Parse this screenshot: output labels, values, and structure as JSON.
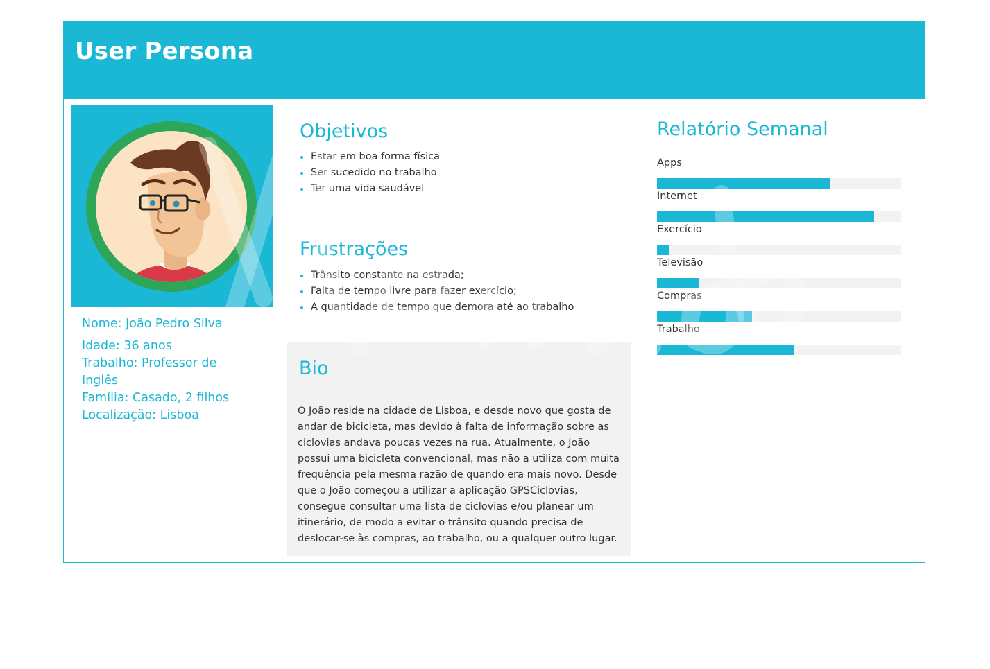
{
  "header": {
    "title": "User Persona"
  },
  "profile": {
    "name": "Nome: João Pedro Silva",
    "age": "Idade: 36 anos",
    "job": "Trabalho: Professor de Inglês",
    "family": "Família: Casado, 2 filhos",
    "location": "Localização: Lisboa"
  },
  "objectives": {
    "title": "Objetivos",
    "items": [
      "Estar em boa forma física",
      "Ser sucedido no trabalho",
      "Ter uma vida saudável"
    ]
  },
  "frustrations": {
    "title": "Frustrações",
    "items": [
      "Trânsito constante na estrada;",
      "Falta de tempo livre para fazer exercício;",
      "A quantidade de tempo que demora até ao trabalho"
    ]
  },
  "bio": {
    "title": "Bio",
    "text": "O João reside na cidade de Lisboa, e desde novo que gosta de andar de bicicleta, mas devido à falta de informação sobre as ciclovias andava poucas vezes na rua. Atualmente, o João possui uma bicicleta convencional, mas não a utiliza com muita frequência pela mesma razão de quando era mais novo. Desde que o João começou a utilizar a aplicação GPSCiclovias, consegue consultar uma lista de ciclovias e/ou planear um itinerário, de modo a evitar o trânsito quando precisa de deslocar-se às compras, ao trabalho, ou a qualquer outro lugar."
  },
  "weekly_report": {
    "title": "Relatório Semanal",
    "items": [
      {
        "label": "Apps",
        "value": 71
      },
      {
        "label": "Internet",
        "value": 89
      },
      {
        "label": "Exercício",
        "value": 5
      },
      {
        "label": "Televisão",
        "value": 17
      },
      {
        "label": "Compras",
        "value": 39
      },
      {
        "label": "Trabalho",
        "value": 56
      }
    ]
  },
  "colors": {
    "accent": "#1bb8d6",
    "track": "#f2f2f2",
    "avatar_ring": "#2ea65a"
  },
  "icons": {
    "avatar": "cartoon-man-with-glasses"
  }
}
